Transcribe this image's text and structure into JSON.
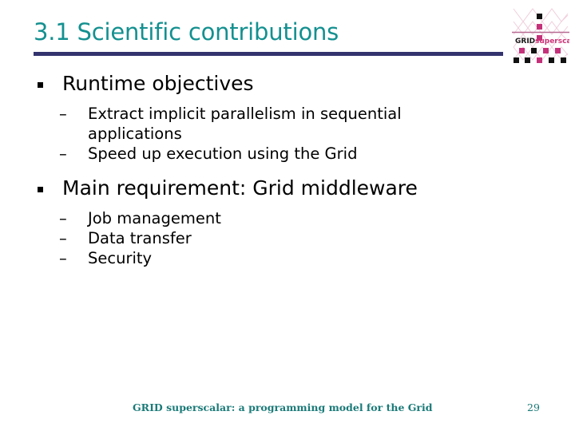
{
  "slide": {
    "title": "3.1 Scientific contributions",
    "accent_title_color": "#149090",
    "rule_color": "#33336e",
    "footer_color": "#1a7a78",
    "logo": {
      "name": "grid-superscalar-logo",
      "word_one": "GRID",
      "word_two": "superscalar",
      "word_one_color": "#1a1a1a",
      "word_two_color": "#cc3377"
    },
    "content": [
      {
        "level": 1,
        "marker": "square-bullet",
        "text": "Runtime objectives"
      },
      {
        "level": 2,
        "marker": "–",
        "text": "Extract implicit parallelism in sequential applications"
      },
      {
        "level": 2,
        "marker": "–",
        "text": "Speed up execution using the Grid"
      },
      {
        "level": 1,
        "marker": "square-bullet",
        "text": "Main requirement: Grid middleware"
      },
      {
        "level": 2,
        "marker": "–",
        "text": "Job management"
      },
      {
        "level": 2,
        "marker": "–",
        "text": "Data transfer"
      },
      {
        "level": 2,
        "marker": "–",
        "text": "Security"
      }
    ],
    "footer": {
      "text": "GRID superscalar: a programming model for the Grid",
      "page_number": "29"
    }
  }
}
